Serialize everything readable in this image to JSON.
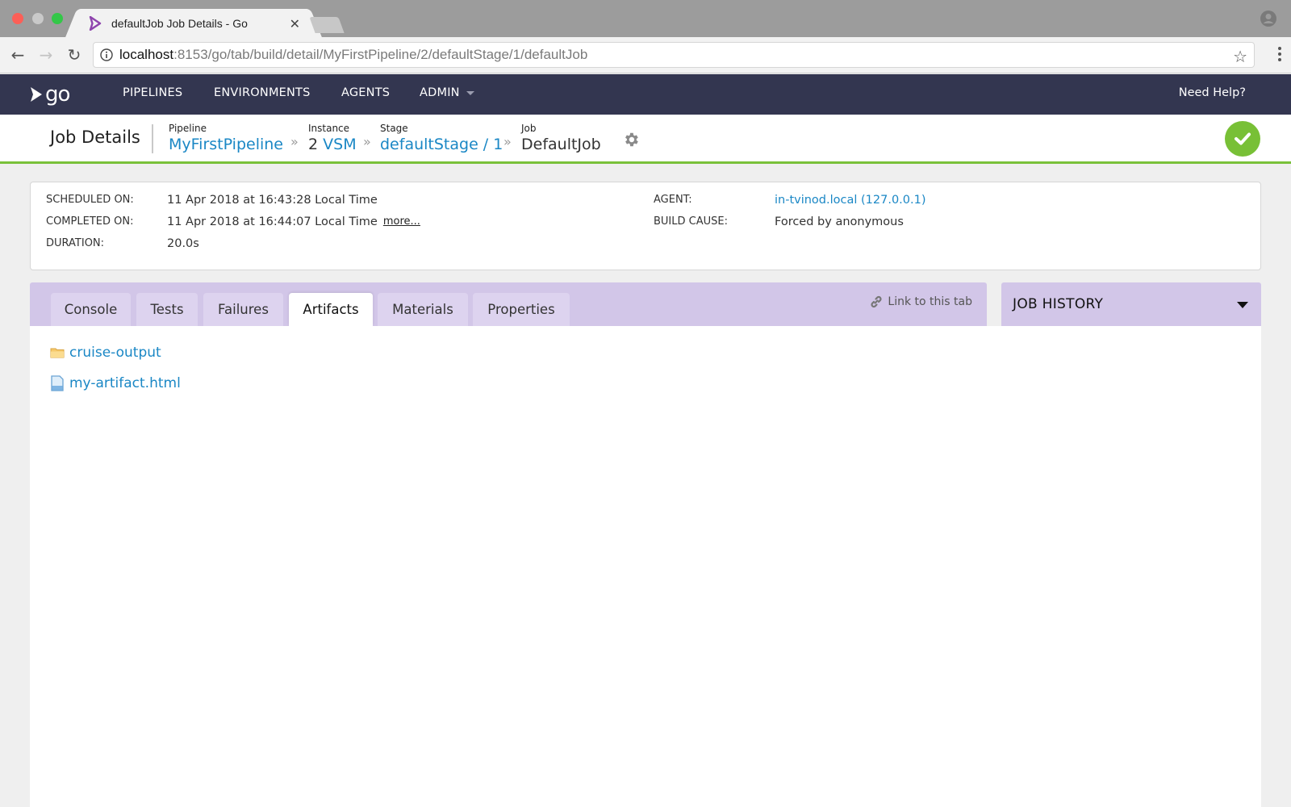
{
  "browser": {
    "tab_title": "defaultJob Job Details - Go",
    "url_host": "localhost",
    "url_rest": ":8153/go/tab/build/detail/MyFirstPipeline/2/defaultStage/1/defaultJob"
  },
  "appnav": {
    "logo_text": "go",
    "items": [
      {
        "label": "PIPELINES"
      },
      {
        "label": "ENVIRONMENTS"
      },
      {
        "label": "AGENTS"
      },
      {
        "label": "ADMIN"
      }
    ],
    "help_label": "Need Help?"
  },
  "header": {
    "title": "Job Details",
    "breadcrumbs": [
      {
        "label": "Pipeline",
        "value": "MyFirstPipeline"
      },
      {
        "label": "Instance",
        "number": "2",
        "value": "VSM"
      },
      {
        "label": "Stage",
        "value": "defaultStage / 1"
      },
      {
        "label": "Job",
        "value": "DefaultJob"
      }
    ],
    "separator": "»",
    "status": "passed",
    "status_color": "#78c036"
  },
  "summary": {
    "scheduled_label": "SCHEDULED ON:",
    "scheduled_value": "11 Apr 2018 at 16:43:28 Local Time",
    "completed_label": "COMPLETED ON:",
    "completed_value": "11 Apr 2018 at 16:44:07 Local Time",
    "more_label": "more...",
    "duration_label": "DURATION:",
    "duration_value": "20.0s",
    "agent_label": "AGENT:",
    "agent_value": "in-tvinod.local (127.0.0.1)",
    "cause_label": "BUILD CAUSE:",
    "cause_value": "Forced by anonymous"
  },
  "tabs": {
    "items": [
      {
        "label": "Console"
      },
      {
        "label": "Tests"
      },
      {
        "label": "Failures"
      },
      {
        "label": "Artifacts",
        "active": true
      },
      {
        "label": "Materials"
      },
      {
        "label": "Properties"
      }
    ],
    "link_label": "Link to this tab"
  },
  "job_history": {
    "title": "JOB HISTORY"
  },
  "artifacts": [
    {
      "name": "cruise-output",
      "type": "folder"
    },
    {
      "name": "my-artifact.html",
      "type": "file"
    }
  ],
  "colors": {
    "nav_bg": "#333650",
    "link": "#1a87c5",
    "tab_bar": "#d2c6e8",
    "success": "#78c036"
  }
}
